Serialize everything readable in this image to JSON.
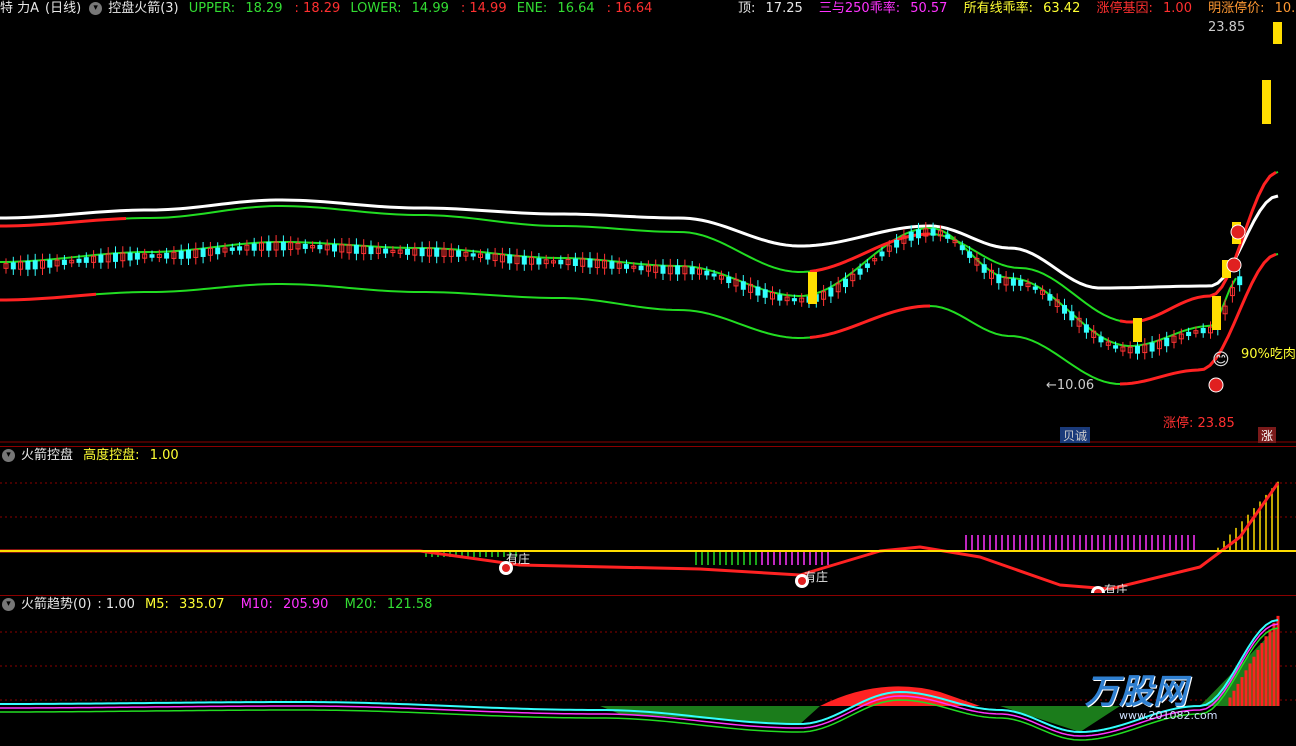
{
  "colors": {
    "bg": "#000000",
    "up": "#ff3333",
    "down": "#33ffff",
    "green": "#22dd22",
    "white": "#ffffff",
    "yellow": "#ffee00",
    "magenta": "#ff33ff"
  },
  "main": {
    "stock_name": "特 力A",
    "period": "(日线)",
    "indicator": "控盘火箭(3)",
    "upper_label": "UPPER:",
    "upper_val1": "18.29",
    "upper_val2": ": 18.29",
    "lower_label": "LOWER:",
    "lower_val1": "14.99",
    "lower_val2": ": 14.99",
    "ene_label": "ENE:",
    "ene_val1": "16.64",
    "ene_val2": ": 16.64",
    "top_label": "顶:",
    "top_val": "17.25",
    "ratio250_label": "三与250乖率:",
    "ratio250_val": "50.57",
    "allratio_label": "所有线乖率:",
    "allratio_val": "63.42",
    "limitgene_label": "涨停基因:",
    "limitgene_val": "1.00",
    "nextlimit_label": "明涨停价:",
    "nextlimit_val": "10.",
    "high_price": "23.85",
    "low_price": "←10.06",
    "limit_text": "涨停:  23.85",
    "eat_text": "90%吃肉",
    "tag_bottom": "贝诚",
    "tag_limit": "涨"
  },
  "ind1": {
    "name": "火箭控盘",
    "line_label": "高度控盘:",
    "line_val": "1.00",
    "markers": [
      "有庄",
      "有庄",
      "有庄"
    ]
  },
  "ind2": {
    "name": "火箭趋势(0)",
    "val": ": 1.00",
    "m5_label": "M5:",
    "m5_val": "335.07",
    "m10_label": "M10:",
    "m10_val": "205.90",
    "m20_label": "M20:",
    "m20_val": "121.58"
  },
  "watermark": {
    "brand": "万股网",
    "url": "www.201082.com"
  }
}
